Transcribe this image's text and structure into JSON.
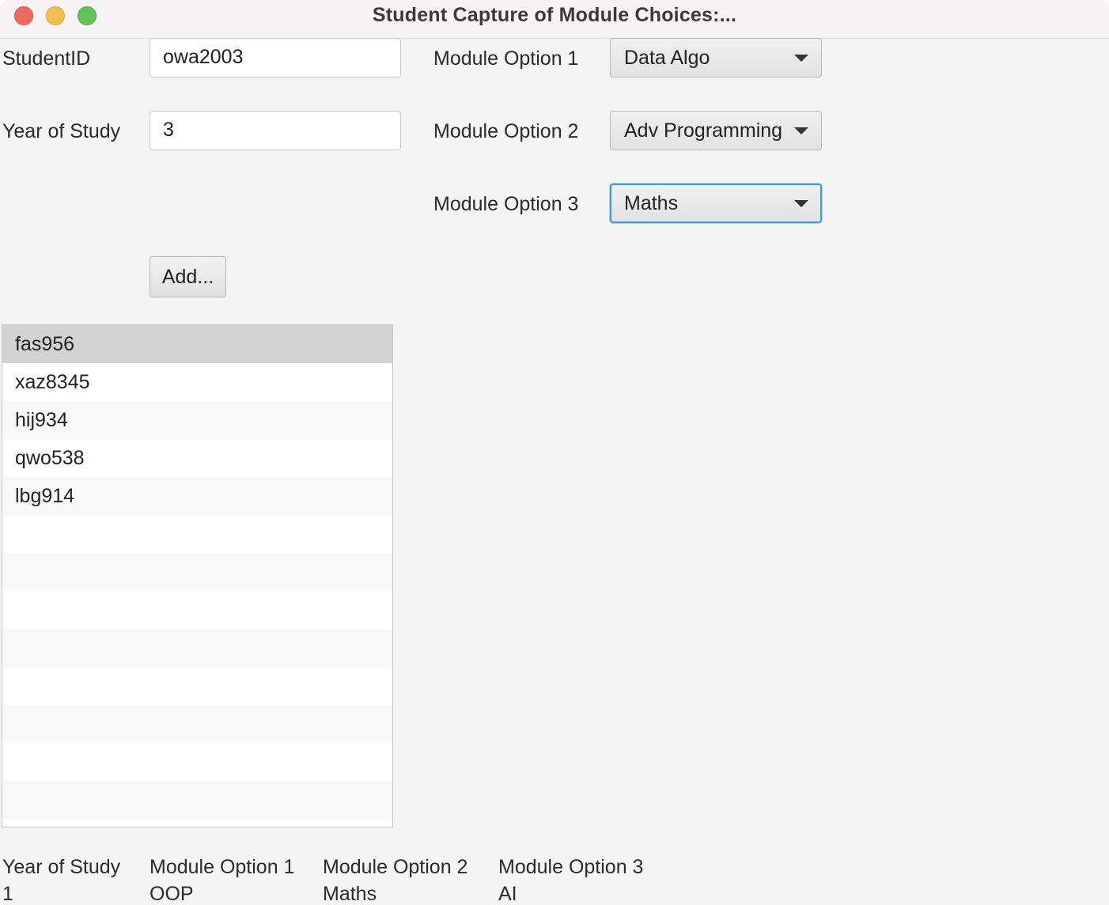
{
  "window": {
    "title": "Student Capture of Module Choices:..."
  },
  "form": {
    "student_id_label": "StudentID",
    "student_id_value": "owa2003",
    "year_label": "Year of Study",
    "year_value": "3",
    "module1_label": "Module Option 1",
    "module1_value": "Data Algo",
    "module2_label": "Module Option 2",
    "module2_value": "Adv Programming",
    "module3_label": "Module Option 3",
    "module3_value": "Maths",
    "add_button_label": "Add..."
  },
  "student_list": {
    "items": [
      "fas956",
      "xaz8345",
      "hij934",
      "qwo538",
      "lbg914"
    ],
    "selected_index": 0,
    "total_rows": 13
  },
  "details": {
    "headers": {
      "year": "Year of Study",
      "module1": "Module Option 1",
      "module2": "Module Option 2",
      "module3": "Module Option 3"
    },
    "values": {
      "year": "1",
      "module1": "OOP",
      "module2": "Maths",
      "module3": "AI"
    }
  },
  "colors": {
    "focus_ring": "#3d9be0",
    "selected_row": "#d3d3d3",
    "close": "#ed6a5e",
    "minimize": "#f5bf4f",
    "maximize": "#61c554"
  }
}
